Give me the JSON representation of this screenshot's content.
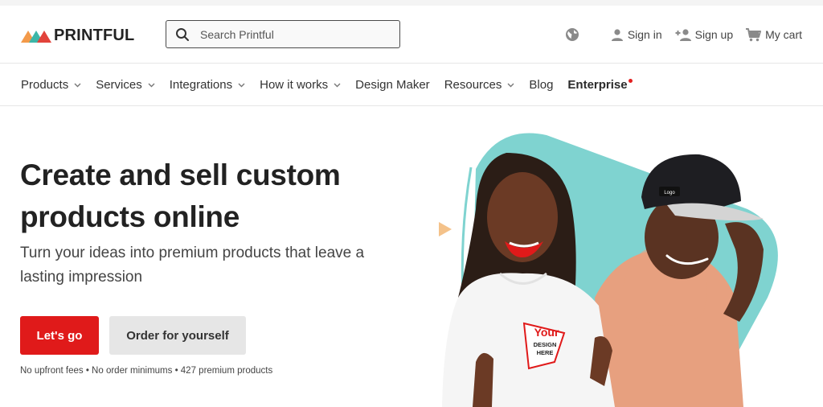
{
  "brand": {
    "name": "PRINTFUL"
  },
  "search": {
    "placeholder": "Search Printful"
  },
  "header_actions": {
    "sign_in": "Sign in",
    "sign_up": "Sign up",
    "cart": "My cart"
  },
  "nav": {
    "items": [
      {
        "label": "Products",
        "dropdown": true
      },
      {
        "label": "Services",
        "dropdown": true
      },
      {
        "label": "Integrations",
        "dropdown": true
      },
      {
        "label": "How it works",
        "dropdown": true
      },
      {
        "label": "Design Maker",
        "dropdown": false
      },
      {
        "label": "Resources",
        "dropdown": true
      },
      {
        "label": "Blog",
        "dropdown": false
      }
    ],
    "enterprise": "Enterprise"
  },
  "hero": {
    "title": "Create and sell custom products online",
    "subtitle": "Turn your ideas into premium products that leave a lasting impression",
    "primary_cta": "Let's go",
    "secondary_cta": "Order for yourself",
    "fineprint": "No upfront fees • No order minimums • 427 premium products"
  },
  "artwork": {
    "hoodie_print": {
      "line1": "Your",
      "line2": "DESIGN",
      "line3": "HERE"
    },
    "cap_print": "Logo"
  },
  "colors": {
    "accent_red": "#e01a1a",
    "teal": "#7fd3d0",
    "logo_orange": "#f39a4a",
    "logo_teal": "#3cb6a8",
    "logo_red": "#e2433b"
  },
  "icons": {
    "search": "search-icon",
    "globe": "globe-icon",
    "user": "user-icon",
    "add_user": "add-user-icon",
    "cart": "cart-icon",
    "chevron": "chevron-down-icon"
  }
}
